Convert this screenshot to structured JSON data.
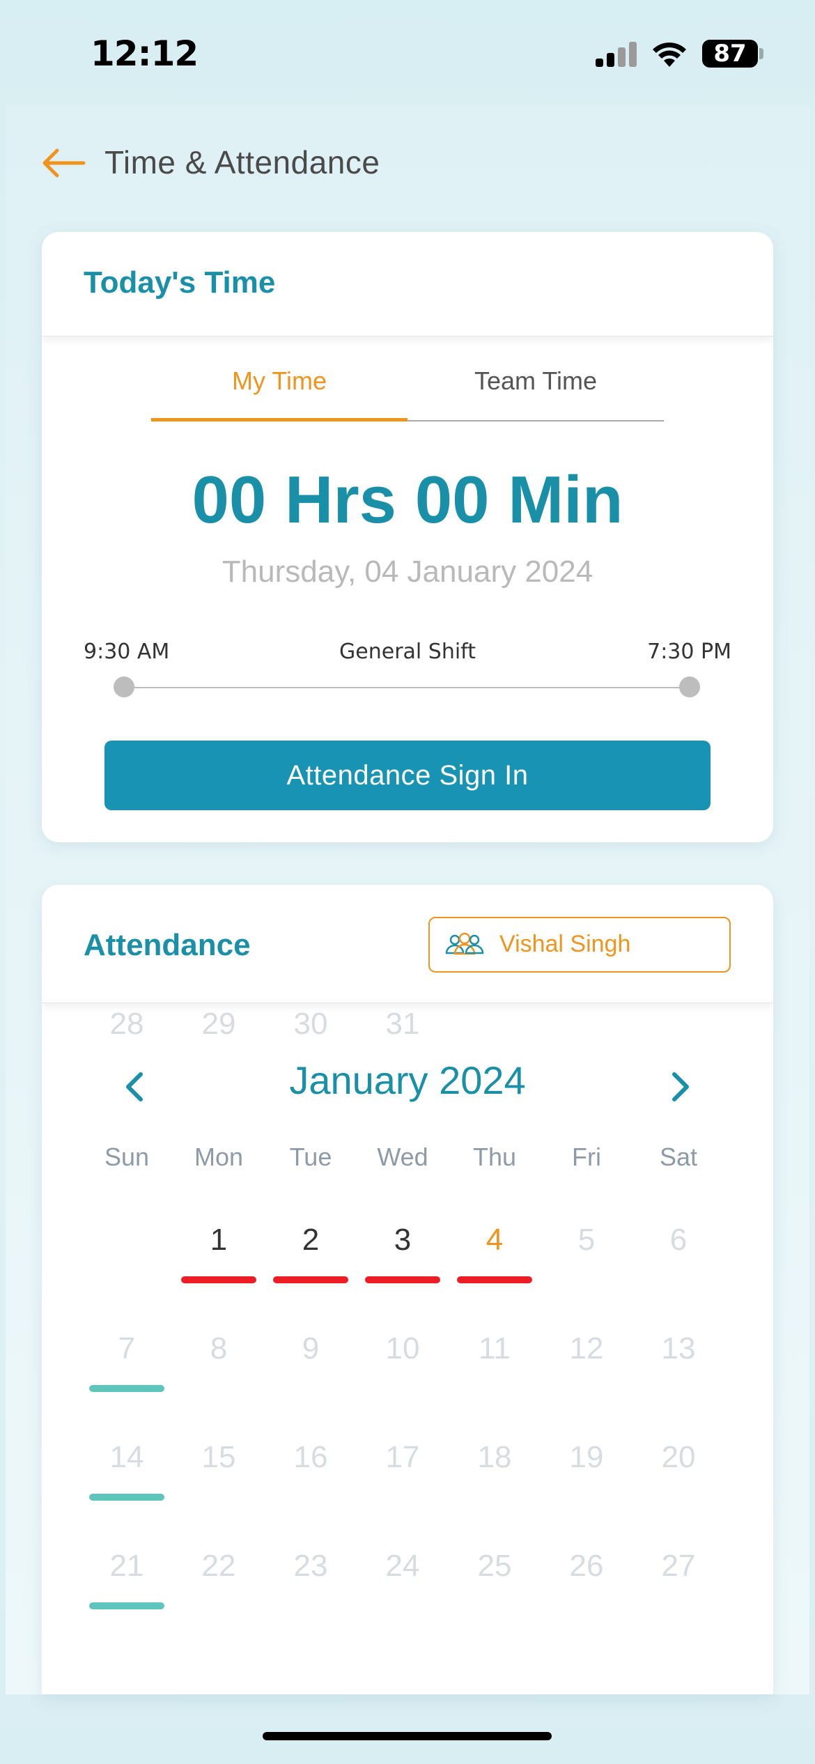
{
  "status_bar": {
    "time": "12:12",
    "battery": "87"
  },
  "header": {
    "title": "Time & Attendance"
  },
  "todays_time": {
    "title": "Today's Time",
    "tabs": [
      {
        "label": "My Time",
        "active": true
      },
      {
        "label": "Team Time",
        "active": false
      }
    ],
    "hours": "00 Hrs 00 Min",
    "date": "Thursday, 04 January 2024",
    "shift": {
      "start": "9:30 AM",
      "name": "General Shift",
      "end": "7:30 PM"
    },
    "signin_label": "Attendance Sign In"
  },
  "attendance": {
    "title": "Attendance",
    "employee": "Vishal Singh",
    "month_title": "January 2024",
    "weekdays": [
      "Sun",
      "Mon",
      "Tue",
      "Wed",
      "Thu",
      "Fri",
      "Sat"
    ],
    "days": [
      {
        "n": "1",
        "state": "active",
        "marker": "red"
      },
      {
        "n": "2",
        "state": "active",
        "marker": "red"
      },
      {
        "n": "3",
        "state": "active",
        "marker": "red"
      },
      {
        "n": "4",
        "state": "today",
        "marker": "red"
      },
      {
        "n": "5",
        "state": "dim",
        "marker": ""
      },
      {
        "n": "6",
        "state": "dim",
        "marker": ""
      },
      {
        "n": "7",
        "state": "dim",
        "marker": "teal"
      },
      {
        "n": "8",
        "state": "dim",
        "marker": ""
      },
      {
        "n": "9",
        "state": "dim",
        "marker": ""
      },
      {
        "n": "10",
        "state": "dim",
        "marker": ""
      },
      {
        "n": "11",
        "state": "dim",
        "marker": ""
      },
      {
        "n": "12",
        "state": "dim",
        "marker": ""
      },
      {
        "n": "13",
        "state": "dim",
        "marker": ""
      },
      {
        "n": "14",
        "state": "dim",
        "marker": "teal"
      },
      {
        "n": "15",
        "state": "dim",
        "marker": ""
      },
      {
        "n": "16",
        "state": "dim",
        "marker": ""
      },
      {
        "n": "17",
        "state": "dim",
        "marker": ""
      },
      {
        "n": "18",
        "state": "dim",
        "marker": ""
      },
      {
        "n": "19",
        "state": "dim",
        "marker": ""
      },
      {
        "n": "20",
        "state": "dim",
        "marker": ""
      },
      {
        "n": "21",
        "state": "dim",
        "marker": "teal"
      },
      {
        "n": "22",
        "state": "dim",
        "marker": ""
      },
      {
        "n": "23",
        "state": "dim",
        "marker": ""
      },
      {
        "n": "24",
        "state": "dim",
        "marker": ""
      },
      {
        "n": "25",
        "state": "dim",
        "marker": ""
      },
      {
        "n": "26",
        "state": "dim",
        "marker": ""
      },
      {
        "n": "27",
        "state": "dim",
        "marker": ""
      },
      {
        "n": "28",
        "state": "dim",
        "marker": ""
      },
      {
        "n": "29",
        "state": "dim",
        "marker": ""
      },
      {
        "n": "30",
        "state": "dim",
        "marker": ""
      },
      {
        "n": "31",
        "state": "dim",
        "marker": ""
      }
    ]
  },
  "icons": {
    "back": "arrow-left-icon",
    "employee": "people-icon",
    "prev": "chevron-left-icon",
    "next": "chevron-right-icon"
  },
  "colors": {
    "accent": "#1a8fa8",
    "orange": "#f0941e",
    "absent": "#ee1c25",
    "weekend": "#5ec5bd",
    "button": "#1893b3"
  }
}
